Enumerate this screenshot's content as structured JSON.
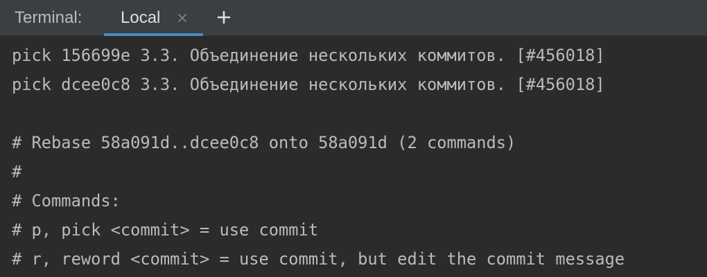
{
  "toolwindow": {
    "title": "Terminal:",
    "tabs": [
      {
        "label": "Local",
        "active": true
      }
    ],
    "close_icon": "close-icon",
    "add_icon": "plus-icon"
  },
  "colors": {
    "background": "#2b2b2b",
    "header_background": "#3c3f41",
    "text": "#bbbbbb",
    "active_tab_underline": "#4a88c7"
  },
  "terminal": {
    "lines": [
      "pick 156699e 3.3. Объединение нескольких коммитов. [#456018]",
      "pick dcee0c8 3.3. Объединение нескольких коммитов. [#456018]",
      "",
      "# Rebase 58a091d..dcee0c8 onto 58a091d (2 commands)",
      "#",
      "# Commands:",
      "# p, pick <commit> = use commit",
      "# r, reword <commit> = use commit, but edit the commit message"
    ]
  }
}
